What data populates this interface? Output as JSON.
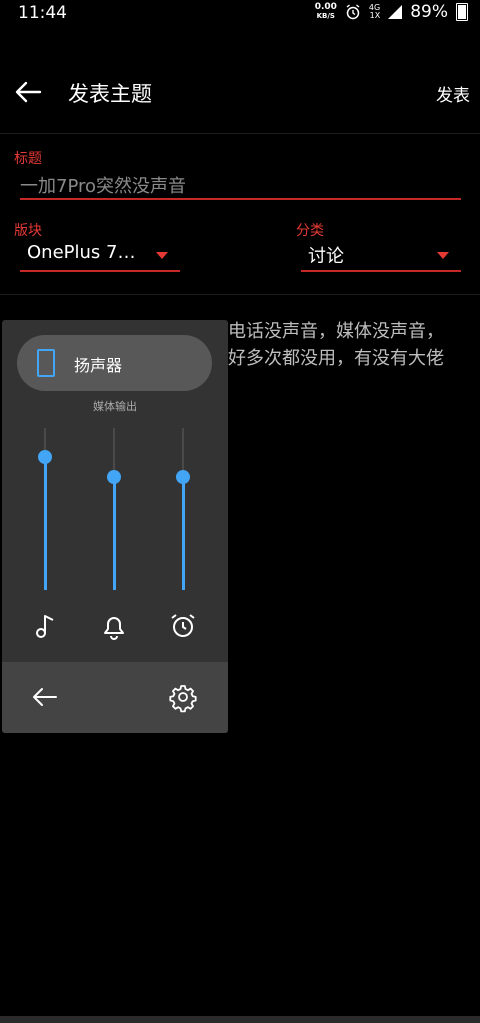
{
  "status_bar": {
    "time": "11:44",
    "net_speed": "0.00",
    "net_unit": "KB/S",
    "signal_top": "4G",
    "signal_bottom": "1X",
    "battery": "89%"
  },
  "app_bar": {
    "title": "发表主题",
    "publish_label": "发表"
  },
  "form": {
    "title_label": "标题",
    "title_value": "一加7Pro突然没声音",
    "board_label": "版块",
    "board_value": "OnePlus 7…",
    "category_label": "分类",
    "category_value": "讨论",
    "body_line1": "电话没声音，媒体没声音，",
    "body_line2": "好多次都没用，有没有大佬"
  },
  "volume_panel": {
    "output_device": "扬声器",
    "output_caption": "媒体输出",
    "sliders": [
      {
        "name": "media",
        "level": 0.82,
        "icon": "music-note-icon"
      },
      {
        "name": "ring",
        "level": 0.7,
        "icon": "bell-icon"
      },
      {
        "name": "alarm",
        "level": 0.7,
        "icon": "alarm-clock-icon"
      }
    ]
  },
  "colors": {
    "accent": "#e53935",
    "slider": "#42a5f5",
    "panel": "#333333"
  }
}
